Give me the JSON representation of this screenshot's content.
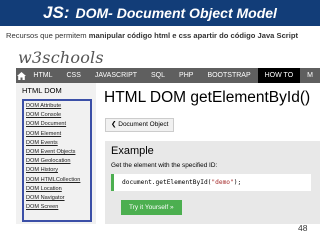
{
  "slide": {
    "title_js": "JS:",
    "title_rest": "DOM- Document Object Model",
    "subtitle_normal": "Recursos que permitem ",
    "subtitle_bold": "manipular código html e css apartir do código Java Script",
    "page_number": "48"
  },
  "colors": {
    "title_bar": "#123d78",
    "nav_bar": "#5f5f5f",
    "accent_green": "#4caf50",
    "sidebar_highlight": "#3b4fa7"
  },
  "site": {
    "logo_w3": "w3",
    "logo_schools": "schools",
    "home_icon": "home-icon",
    "nav_items": [
      "HTML",
      "CSS",
      "JAVASCRIPT",
      "SQL",
      "PHP",
      "BOOTSTRAP",
      "HOW TO",
      "M"
    ]
  },
  "sidebar": {
    "heading": "HTML DOM",
    "links": [
      "DOM Attribute",
      "DOM Console",
      "DOM Document",
      "DOM Element",
      "DOM Events",
      "DOM Event Objects",
      "DOM Geolocation",
      "DOM History",
      "DOM HTMLCollection",
      "DOM Location",
      "DOM Navigator",
      "DOM Screen"
    ]
  },
  "main": {
    "page_title": "HTML DOM getElementById()",
    "prev_button": "❮ Document Object",
    "example": {
      "heading": "Example",
      "description": "Get the element with the specified ID:",
      "code_prefix": "document.getElementById(",
      "code_string": "\"demo\"",
      "code_suffix": ");",
      "try_button": "Try it Yourself »"
    }
  }
}
